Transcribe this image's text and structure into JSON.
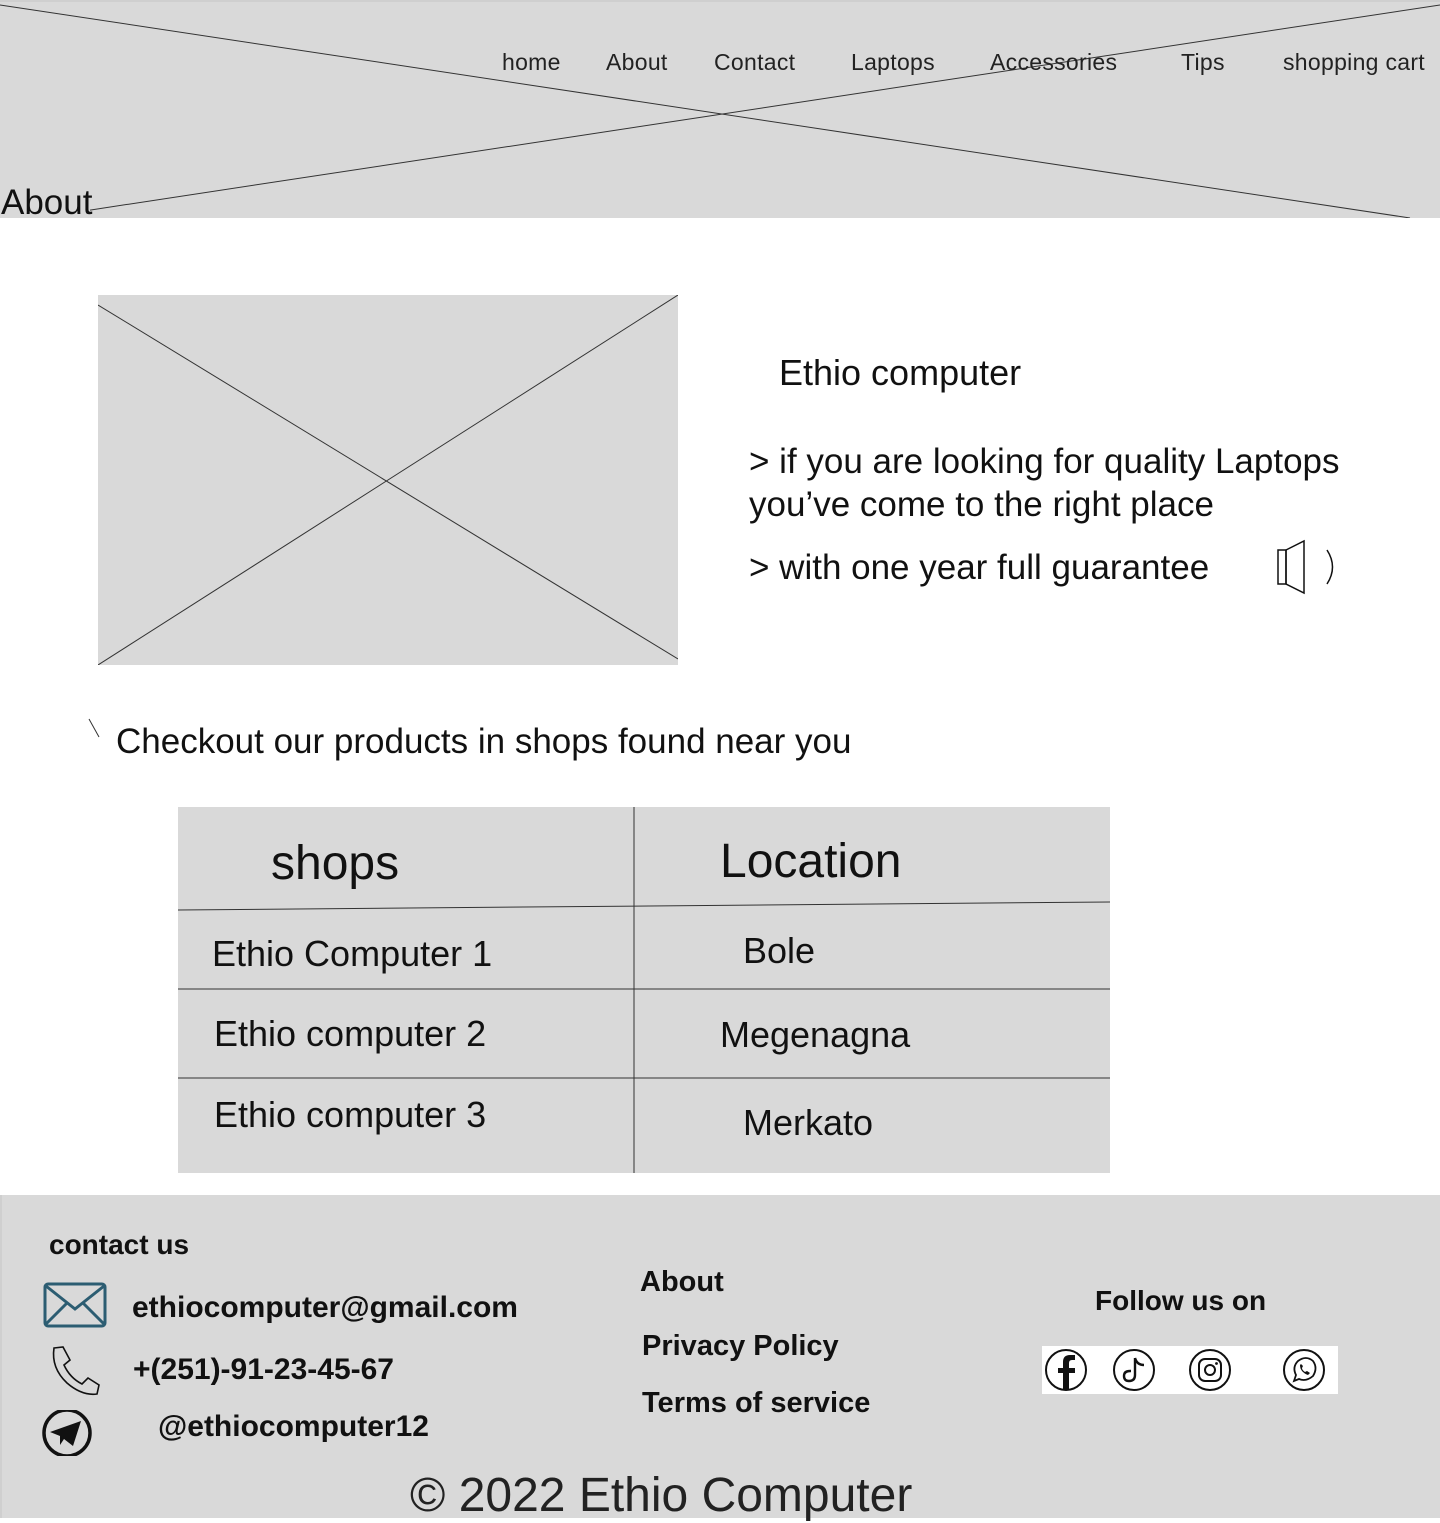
{
  "header": {
    "nav": [
      {
        "label": "home"
      },
      {
        "label": "About"
      },
      {
        "label": "Contact"
      },
      {
        "label": "Laptops"
      },
      {
        "label": "Accessories"
      },
      {
        "label": "Tips"
      },
      {
        "label": "shopping cart"
      }
    ],
    "page_title": "About"
  },
  "hero": {
    "brand": "Ethio computer",
    "line1": "> if you are looking for quality Laptops",
    "line2": "you’ve come to the right place",
    "line3": "> with one year full guarantee"
  },
  "shops": {
    "heading": "Checkout our products in shops found near you",
    "columns": [
      "shops",
      "Location"
    ],
    "rows": [
      [
        "Ethio Computer 1",
        "Bole"
      ],
      [
        "Ethio computer 2",
        "Megenagna"
      ],
      [
        "Ethio computer 3",
        "Merkato"
      ]
    ]
  },
  "footer": {
    "contact_title": "contact us",
    "email": "ethiocomputer@gmail.com",
    "phone": "+(251)-91-23-45-67",
    "telegram": "@ethiocomputer12",
    "about": "About",
    "privacy": "Privacy Policy",
    "terms": "Terms of service",
    "follow_title": "Follow us on",
    "social": [
      "facebook-icon",
      "tiktok-icon",
      "instagram-icon",
      "whatsapp-icon"
    ],
    "copyright": "© 2022 Ethio Computer"
  },
  "colors": {
    "placeholder": "#d9d9d9",
    "email_icon": "#2c5d72"
  }
}
